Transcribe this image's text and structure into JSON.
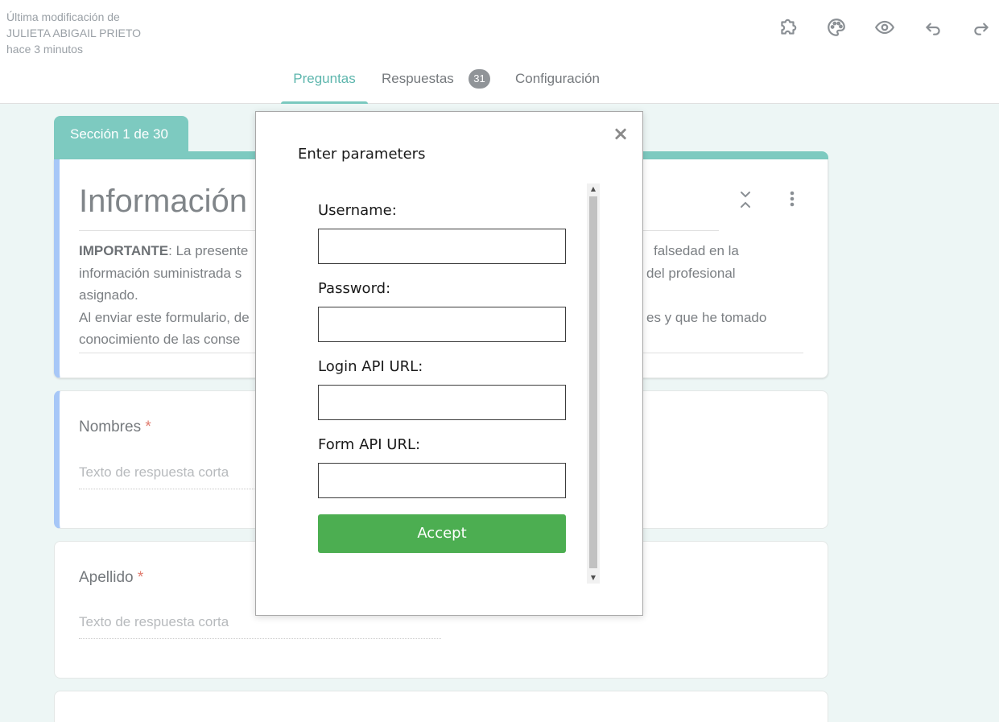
{
  "header": {
    "last_modified_line1": "Última modificación de",
    "last_modified_line2": "JULIETA ABIGAIL PRIETO",
    "last_modified_line3": "hace 3 minutos",
    "toolbar_icons": [
      "puzzle-icon",
      "palette-icon",
      "eye-icon",
      "undo-icon",
      "redo-icon"
    ]
  },
  "tabs": {
    "questions": "Preguntas",
    "responses": "Respuestas",
    "responses_count": "31",
    "settings": "Configuración"
  },
  "section": {
    "label": "Sección 1 de 30",
    "title": "Información",
    "description_bold": "IMPORTANTE",
    "description_line1": ": La presente",
    "description_line1_end": "falsedad en la",
    "description_line2": "información suministrada s",
    "description_line2_end": "del profesional",
    "description_line3": "asignado.",
    "description_line4": "Al enviar este formulario, de",
    "description_line4_end": "es y que he tomado",
    "description_line5": "conocimiento de las conse"
  },
  "questions": [
    {
      "label": "Nombres",
      "required": "*",
      "placeholder": "Texto de respuesta corta"
    },
    {
      "label": "Apellido",
      "required": "*",
      "placeholder": "Texto de respuesta corta"
    }
  ],
  "modal": {
    "title": "Enter parameters",
    "close": "×",
    "fields": [
      {
        "label": "Username:",
        "value": ""
      },
      {
        "label": "Password:",
        "value": ""
      },
      {
        "label": "Login API URL:",
        "value": ""
      },
      {
        "label": "Form API URL:",
        "value": ""
      }
    ],
    "accept_label": "Accept"
  },
  "colors": {
    "accent": "#7dcac0",
    "accent_text": "#5db6ad",
    "accept_button": "#4cae51",
    "focus_border": "#a7c7f7",
    "required": "#e07b6e"
  }
}
